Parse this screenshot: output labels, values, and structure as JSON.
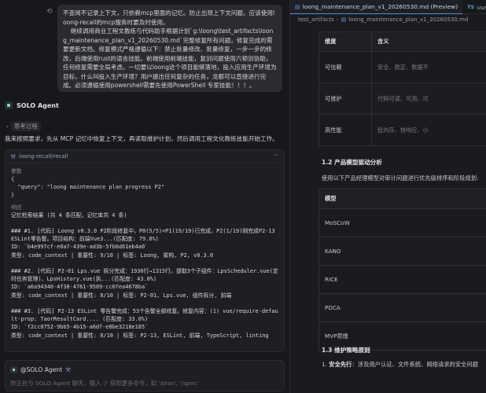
{
  "chat": {
    "user_message": "不查阅不记录上下文，只依赖mcp里面的记忆。防止出现上下文问题，应该使用loong-recall的mcp服务时要及时使用。\n    继续调用商业工程文教练与代码助手根据计划`g:\\loong\\test_artifacts\\loong_maintenance_plan_v1_20260530.md`完整修复所有问题，修复完成的需要更新文档。修复模式严格遵循以下：禁止批量修改、批量修复，一步一步的修改，后端使用rust的语言技能。前端使用前端技能，复剑问题使用六顿剑协助，任何修复需要全局考虑。一切要以loong这个项目能够落地，投入应用生产环境为目标，什么叫投入生产环境？用户提出任何复杂的任务，龙都可以直接进行完成。必须遵循使用powershell需要先使用PowerShell 专家技能！！！。",
    "agent_name": "SOLO Agent",
    "thinking_label": "思考过程",
    "agent_message": "我来按照要求，先从 MCP 记忆中恢复上下文，再读取维护计划，然后调用工程文化教练技能开始工作。",
    "tool": {
      "name": "loong-recall/recall",
      "params_label": "参数",
      "params_code": "{\n  \"query\": \"loong maintenance plan progress P2\"\n}",
      "result_label": "响应",
      "result_text": "记忆检索结果 (共 4 条匹配，记忆库共 4 条)\n\n### #1. [代码] Loong v0.3.0 P2阶段修复中。P0(5/5)+P1(19/19)已完成，P2(1/19)刚完成P2-13 ESLint零告警。项目结构：前端Vue3...(匹配度: 79.8%)\nID: `b4e997cf-e0a7-439e-ad3b-5fb6d61eb4a0`\n类型: code_context | 重要性: 9/10 | 标签: Loong, 架构, P2, v0.3.0\n\n### #2. [代码] P2-01 Lps.vue 拆分完成：1936行→1315行。提取3个子组件：LpsScheduler.vue(定时任务管理)、LpsHistory.vue(执...(匹配度: 43.8%)\nID: `a6a94340-4f38-4761-9509-cc6fea4678ba`\n类型: code_context | 重要性: 8/10 | 标签: P2-01, Lps.vue, 组件拆分, 前端\n\n### #3. [代码] P2-13 ESLint 零告警完成：53个告警全部修复。修复内容：(1) vue/require-default-prop: TaorResultCard.... (匹配度: 33.0%)\nID: `f2cc0752-9bb5-4b15-a6df-e8be3218e185`\n类型: code_context | 重要性: 8/10 | 标签: P2-13, ESLint, 前端, TypeScript, linting"
    },
    "input": {
      "agent_label": "@SOLO Agent",
      "placeholder": "你正在与 SOLO Agent 聊天，输入 '/' 获取更多命令，如 '/plan', '/spec'"
    }
  },
  "editor": {
    "tabs": [
      {
        "label": "loong_maintenance_plan_v1_20260530.md (Preview)",
        "icon": "file-icon"
      },
      {
        "label": "useChatH",
        "icon": "ts-icon",
        "prefix": "TS"
      }
    ],
    "breadcrumb": [
      "test_artifacts",
      "loong_maintenance_plan_v1_20260530.md"
    ],
    "partial_heading": "…",
    "table1": {
      "headers": [
        "维度",
        "含义"
      ],
      "rows": [
        [
          "可信赖",
          "安全、稳定、数据不"
        ],
        [
          "可维护",
          "代码可读、可测、可"
        ],
        [
          "高性能",
          "低内存、快响应、小"
        ]
      ]
    },
    "section_1_2": "1.2 产品模型驱动分析",
    "section_1_2_desc": "使用以下产品经理模型对审计问题进行优先级排序和阶段规划:",
    "table2": {
      "headers": [
        "模型"
      ],
      "rows": [
        [
          "MoSCoW"
        ],
        [
          "KANO"
        ],
        [
          "RICE"
        ],
        [
          "PDCA"
        ],
        [
          "MVP思维"
        ]
      ]
    },
    "section_1_3": "1.3 维护策略原则",
    "list_item_1_bold": "安全先行",
    "list_item_1_text": "：涉及用户认证、文件系统、网络请求的安全问题"
  }
}
